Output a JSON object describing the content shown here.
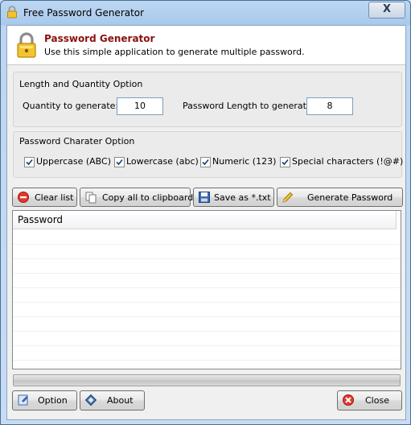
{
  "window": {
    "title": "Free Password Generator",
    "close_symbol": "X"
  },
  "header": {
    "title": "Password Generator",
    "subtitle": "Use this simple application to generate multiple password."
  },
  "length_group": {
    "title": "Length and Quantity Option",
    "quantity_label": "Quantity to generate:",
    "quantity_value": "10",
    "length_label": "Password Length to generate:",
    "length_value": "8"
  },
  "charset_group": {
    "title": "Password Charater Option",
    "options": [
      {
        "label": "Uppercase (ABC)",
        "checked": true
      },
      {
        "label": "Lowercase (abc)",
        "checked": true
      },
      {
        "label": "Numeric (123)",
        "checked": true
      },
      {
        "label": "Special characters (!@#)",
        "checked": true
      }
    ]
  },
  "toolbar": {
    "clear_label": "Clear list",
    "copy_label": "Copy all to clipboard",
    "save_label": "Save as *.txt",
    "generate_label": "Generate Password"
  },
  "list": {
    "column_header": "Password",
    "rows": []
  },
  "progress": {
    "value": 0
  },
  "footer": {
    "option_label": "Option",
    "about_label": "About",
    "close_label": "Close"
  }
}
